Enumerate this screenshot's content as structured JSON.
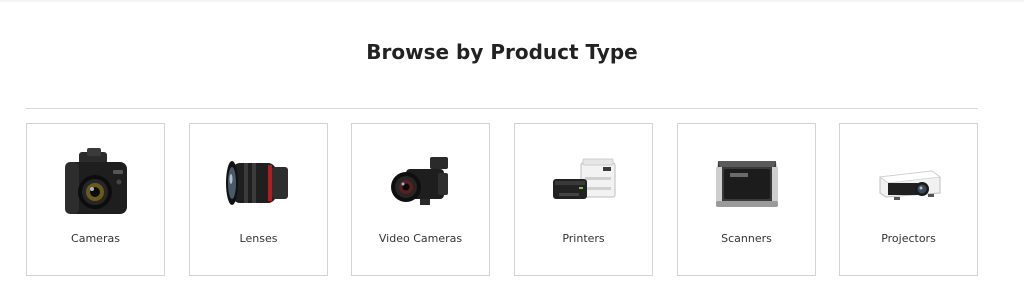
{
  "section": {
    "title": "Browse by Product Type"
  },
  "products": [
    {
      "label": "Cameras",
      "icon": "camera-icon"
    },
    {
      "label": "Lenses",
      "icon": "lens-icon"
    },
    {
      "label": "Video Cameras",
      "icon": "video-camera-icon"
    },
    {
      "label": "Printers",
      "icon": "printer-icon"
    },
    {
      "label": "Scanners",
      "icon": "scanner-icon"
    },
    {
      "label": "Projectors",
      "icon": "projector-icon"
    }
  ]
}
